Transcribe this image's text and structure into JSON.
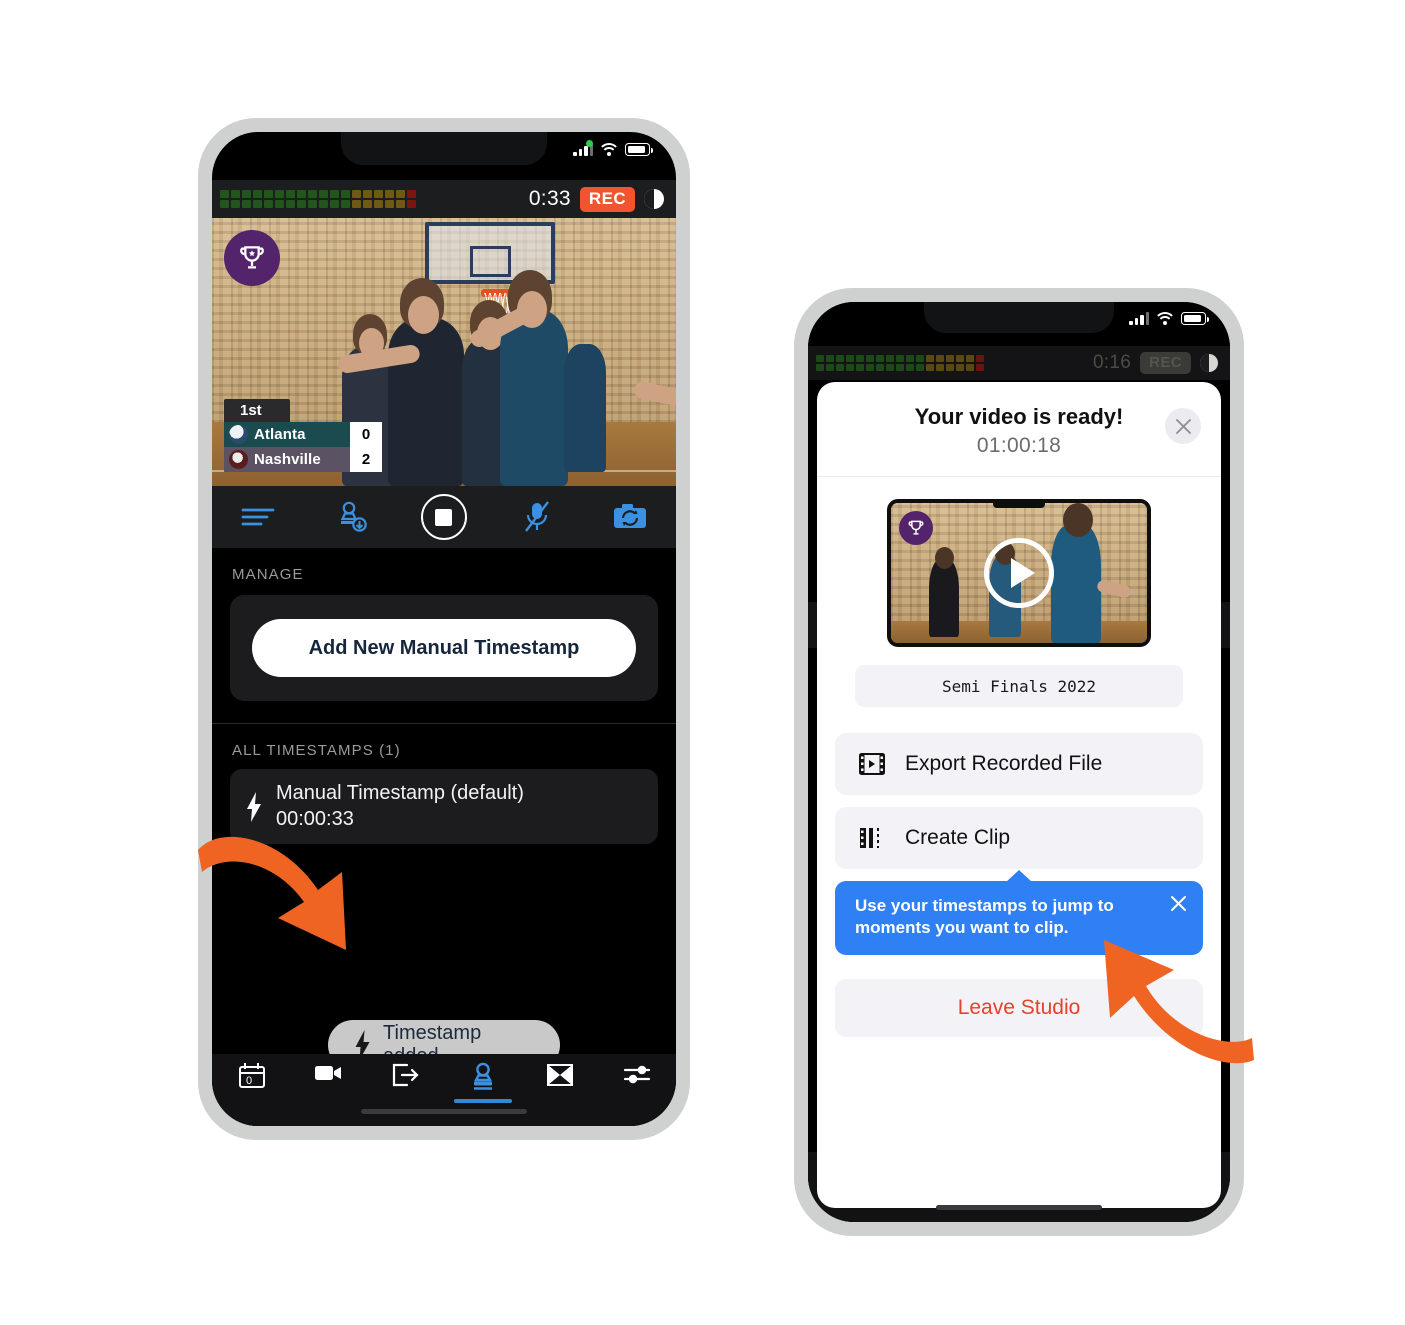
{
  "colors": {
    "orange_arrow": "#f06423",
    "rec_badge": "#f1542e",
    "accent_blue": "#2f89d8",
    "tooltip_blue": "#2f80f5",
    "leave_red": "#e8402a",
    "trophy_purple": "#53236b",
    "phone_frame": "#cfd0d0"
  },
  "left_phone": {
    "status_bar": {
      "signal_icon": "cellular-signal-icon",
      "wifi_icon": "wifi-icon",
      "battery_icon": "battery-icon",
      "recording_dot_icon": "green-recording-dot-icon"
    },
    "app_bar": {
      "audio_meter_icon": "audio-vu-meter-icon",
      "elapsed_time": "0:33",
      "rec_label": "REC",
      "storage_icon": "half-moon-storage-icon"
    },
    "video_overlay": {
      "trophy_icon": "trophy-badge-icon",
      "scoreboard": {
        "period": "1st",
        "rows": [
          {
            "team": "Atlanta",
            "score": "0",
            "logo_icon": "eagle-logo-icon"
          },
          {
            "team": "Nashville",
            "score": "2",
            "logo_icon": "wolf-logo-icon"
          }
        ]
      }
    },
    "control_bar": [
      {
        "name": "lines-menu-icon",
        "label": "Lines"
      },
      {
        "name": "add-stamp-icon",
        "label": "Add Stamp"
      },
      {
        "name": "stop-record-button",
        "label": "Stop"
      },
      {
        "name": "mic-muted-icon",
        "label": "Mic Muted"
      },
      {
        "name": "switch-camera-icon",
        "label": "Switch Camera"
      }
    ],
    "manage": {
      "section_label": "MANAGE",
      "add_button": "Add New Manual Timestamp"
    },
    "timestamps": {
      "section_label": "ALL TIMESTAMPS (1)",
      "items": [
        {
          "icon": "lightning-bolt-icon",
          "title": "Manual Timestamp (default)",
          "time": "00:00:33"
        }
      ]
    },
    "toast": {
      "icon": "lightning-bolt-icon",
      "text": "Timestamp added"
    },
    "bottom_nav": [
      {
        "name": "scoreboard-icon",
        "label": "Scoreboard",
        "active": false
      },
      {
        "name": "video-camera-icon",
        "label": "Camera",
        "active": false
      },
      {
        "name": "export-icon",
        "label": "Export",
        "active": false
      },
      {
        "name": "stamp-icon",
        "label": "Timestamps",
        "active": true
      },
      {
        "name": "transition-icon",
        "label": "Transitions",
        "active": false
      },
      {
        "name": "settings-sliders-icon",
        "label": "Settings",
        "active": false
      }
    ]
  },
  "right_phone": {
    "status_bar": {
      "signal_icon": "cellular-signal-icon",
      "wifi_icon": "wifi-icon",
      "battery_icon": "battery-icon"
    },
    "app_bar": {
      "audio_meter_icon": "audio-vu-meter-icon",
      "elapsed_time": "0:16",
      "rec_label": "REC",
      "storage_icon": "half-moon-storage-icon"
    },
    "modal": {
      "title": "Your video is ready!",
      "duration": "01:00:18",
      "close_icon": "close-x-icon",
      "thumbnail": {
        "trophy_icon": "trophy-badge-icon",
        "play_icon": "play-button-icon"
      },
      "title_field_value": "Semi Finals 2022",
      "actions": [
        {
          "icon": "film-export-icon",
          "label": "Export Recorded File"
        },
        {
          "icon": "film-clip-icon",
          "label": "Create Clip"
        }
      ],
      "tooltip": {
        "text": "Use your timestamps to jump to moments you want to clip.",
        "close_icon": "close-x-icon"
      },
      "leave_label": "Leave Studio"
    }
  },
  "annotations": [
    {
      "name": "orange-arrow-to-toast",
      "points_to": "Timestamp added"
    },
    {
      "name": "orange-arrow-to-tooltip",
      "points_to": "Use your timestamps to jump to moments you want to clip."
    }
  ]
}
